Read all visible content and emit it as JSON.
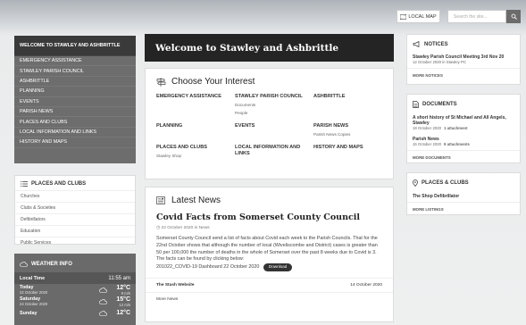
{
  "header": {
    "map_label": "LOCAL MAP",
    "search_placeholder": "Search the site..."
  },
  "nav": {
    "items": [
      "WELCOME TO STAWLEY AND ASHBRITTLE",
      "EMERGENCY ASSISTANCE",
      "STAWLEY PARISH COUNCIL",
      "ASHBRITTLE",
      "PLANNING",
      "EVENTS",
      "PARISH NEWS",
      "PLACES AND CLUBS",
      "LOCAL INFORMATION AND LINKS",
      "HISTORY AND MAPS"
    ]
  },
  "places": {
    "title": "PLACES AND CLUBS",
    "items": [
      "Churches",
      "Clubs & Societies",
      "Defibrillators",
      "Education",
      "Public Services"
    ]
  },
  "weather": {
    "title": "WEATHER INFO",
    "local_label": "Local Time",
    "local_time": "11:55 am",
    "rows": [
      {
        "day": "Today",
        "date": "22 October 2020",
        "temp": "12°C",
        "wind": "9 m/s"
      },
      {
        "day": "Saturday",
        "date": "24 October 2020",
        "temp": "15°C",
        "wind": "12 m/s"
      },
      {
        "day": "Sunday",
        "date": "",
        "temp": "12°C",
        "wind": ""
      }
    ]
  },
  "welcome": {
    "title": "Welcome to Stawley and Ashbrittle"
  },
  "interest": {
    "title": "Choose Your Interest",
    "cells": [
      {
        "t": "EMERGENCY ASSISTANCE",
        "s": []
      },
      {
        "t": "STAWLEY PARISH COUNCIL",
        "s": [
          "Documents",
          "People"
        ]
      },
      {
        "t": "ASHBRITTLE",
        "s": []
      },
      {
        "t": "PLANNING",
        "s": []
      },
      {
        "t": "EVENTS",
        "s": []
      },
      {
        "t": "PARISH NEWS",
        "s": [
          "Parish News Copies"
        ]
      },
      {
        "t": "PLACES AND CLUBS",
        "s": [
          "Stawley Shop"
        ]
      },
      {
        "t": "LOCAL INFORMATION AND LINKS",
        "s": []
      },
      {
        "t": "HISTORY AND MAPS",
        "s": []
      }
    ]
  },
  "news": {
    "title": "Latest News",
    "headline": "Covid Facts from Somerset County Council",
    "date": "22 October 2020",
    "category": "News",
    "body": "Somerset County Council send a list of facts about Covid each week to the Parish Councils. That for the 22nd October shows that although the number of local (Wiveliscombe and District) cases is greater than 50 per 100,000 the number of deaths in the whole of Somerset over the past 8 weeks due to Covid is 3. The facts can be found by clicking below:",
    "file": "201022_COVID-19 Dashboard 22 October 2020",
    "download": "Download",
    "source": "The Stash Website",
    "source_date": "14 October 2020",
    "more": "More News"
  },
  "notices": {
    "title": "NOTICES",
    "entry_title": "Stawley Parish Council Meeting 3rd Nov 20",
    "entry_meta": "12 October 2020 in Stawley PC",
    "more": "MORE NOTICES"
  },
  "documents": {
    "title": "DOCUMENTS",
    "entries": [
      {
        "title": "A short history of St Michael and All Angels, Stawley",
        "meta": "19 October 2020",
        "att": "1 attachment"
      },
      {
        "title": "Parish News",
        "meta": "15 October 2020",
        "att": "9 attachments"
      }
    ],
    "more": "MORE DOCUMENTS"
  },
  "placesclubs": {
    "title": "PLACES & CLUBS",
    "entry": "The Shop Defibrillator",
    "more": "MORE LISTINGS"
  }
}
